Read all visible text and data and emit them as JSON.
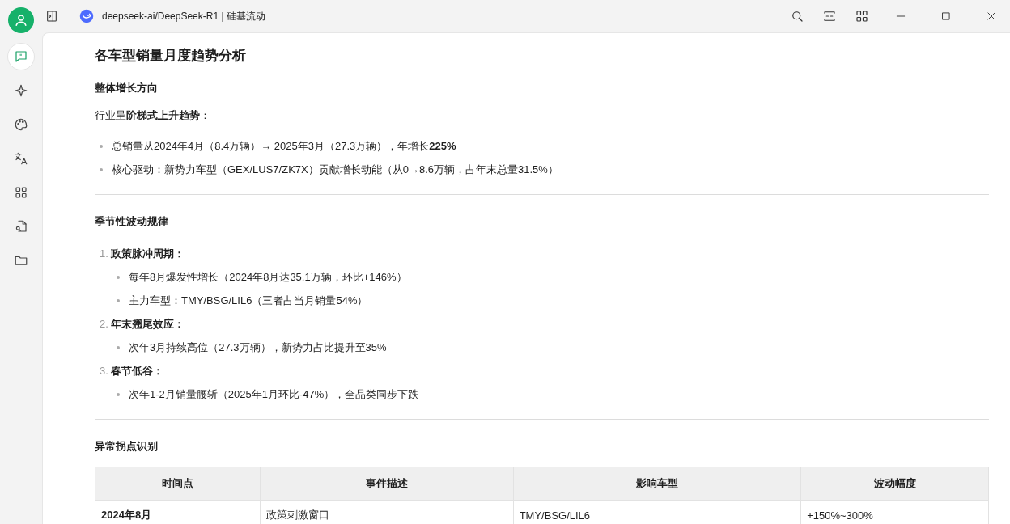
{
  "window": {
    "title": "deepseek-ai/DeepSeek-R1 | 硅基流动"
  },
  "sidebar": {
    "items": [
      {
        "kind": "chat",
        "selected": true
      },
      {
        "kind": "sparkle",
        "selected": false
      },
      {
        "kind": "palette",
        "selected": false
      },
      {
        "kind": "translate",
        "selected": false
      },
      {
        "kind": "grid",
        "selected": false
      },
      {
        "kind": "search",
        "selected": false
      },
      {
        "kind": "folder",
        "selected": false
      }
    ]
  },
  "article": {
    "title": "各车型销量月度趋势分析",
    "sections": [
      {
        "heading": "整体增长方向",
        "blocks": [
          {
            "kind": "paragraph",
            "text": "行业呈**阶梯式上升趋势**："
          },
          {
            "kind": "bullets",
            "items": [
              {
                "text": "总销量从2024年4月（8.4万辆）→ 2025年3月（27.3万辆），年增长**225%**"
              },
              {
                "text": "核心驱动：新势力车型（GEX/LUS7/ZK7X）贡献增长动能（从0→8.6万辆，占年末总量31.5%）"
              }
            ]
          }
        ]
      },
      {
        "heading": "季节性波动规律",
        "blocks": [
          {
            "kind": "numbered",
            "items": [
              {
                "number": "1.",
                "text": "政策脉冲周期：",
                "children": [
                  {
                    "text": "每年8月爆发性增长（2024年8月达35.1万辆，环比+146%）"
                  },
                  {
                    "text": "主力车型：TMY/BSG/LIL6（三者占当月销量54%）"
                  }
                ]
              },
              {
                "number": "2.",
                "text": "年末翘尾效应：",
                "children": [
                  {
                    "text": "次年3月持续高位（27.3万辆），新势力占比提升至35%"
                  }
                ]
              },
              {
                "number": "3.",
                "text": "春节低谷：",
                "children": [
                  {
                    "text": "次年1-2月销量腰斩（2025年1月环比-47%），全品类同步下跌"
                  }
                ]
              }
            ]
          }
        ]
      },
      {
        "heading": "异常拐点识别",
        "blocks": [
          {
            "kind": "table",
            "columns": [
              "时间点",
              "事件描述",
              "影响车型",
              "波动幅度"
            ],
            "rows": [
              [
                "2024年8月",
                "政策刺激窗口",
                "TMY/BSG/LIL6",
                "+150%~300%"
              ]
            ]
          }
        ]
      }
    ]
  }
}
